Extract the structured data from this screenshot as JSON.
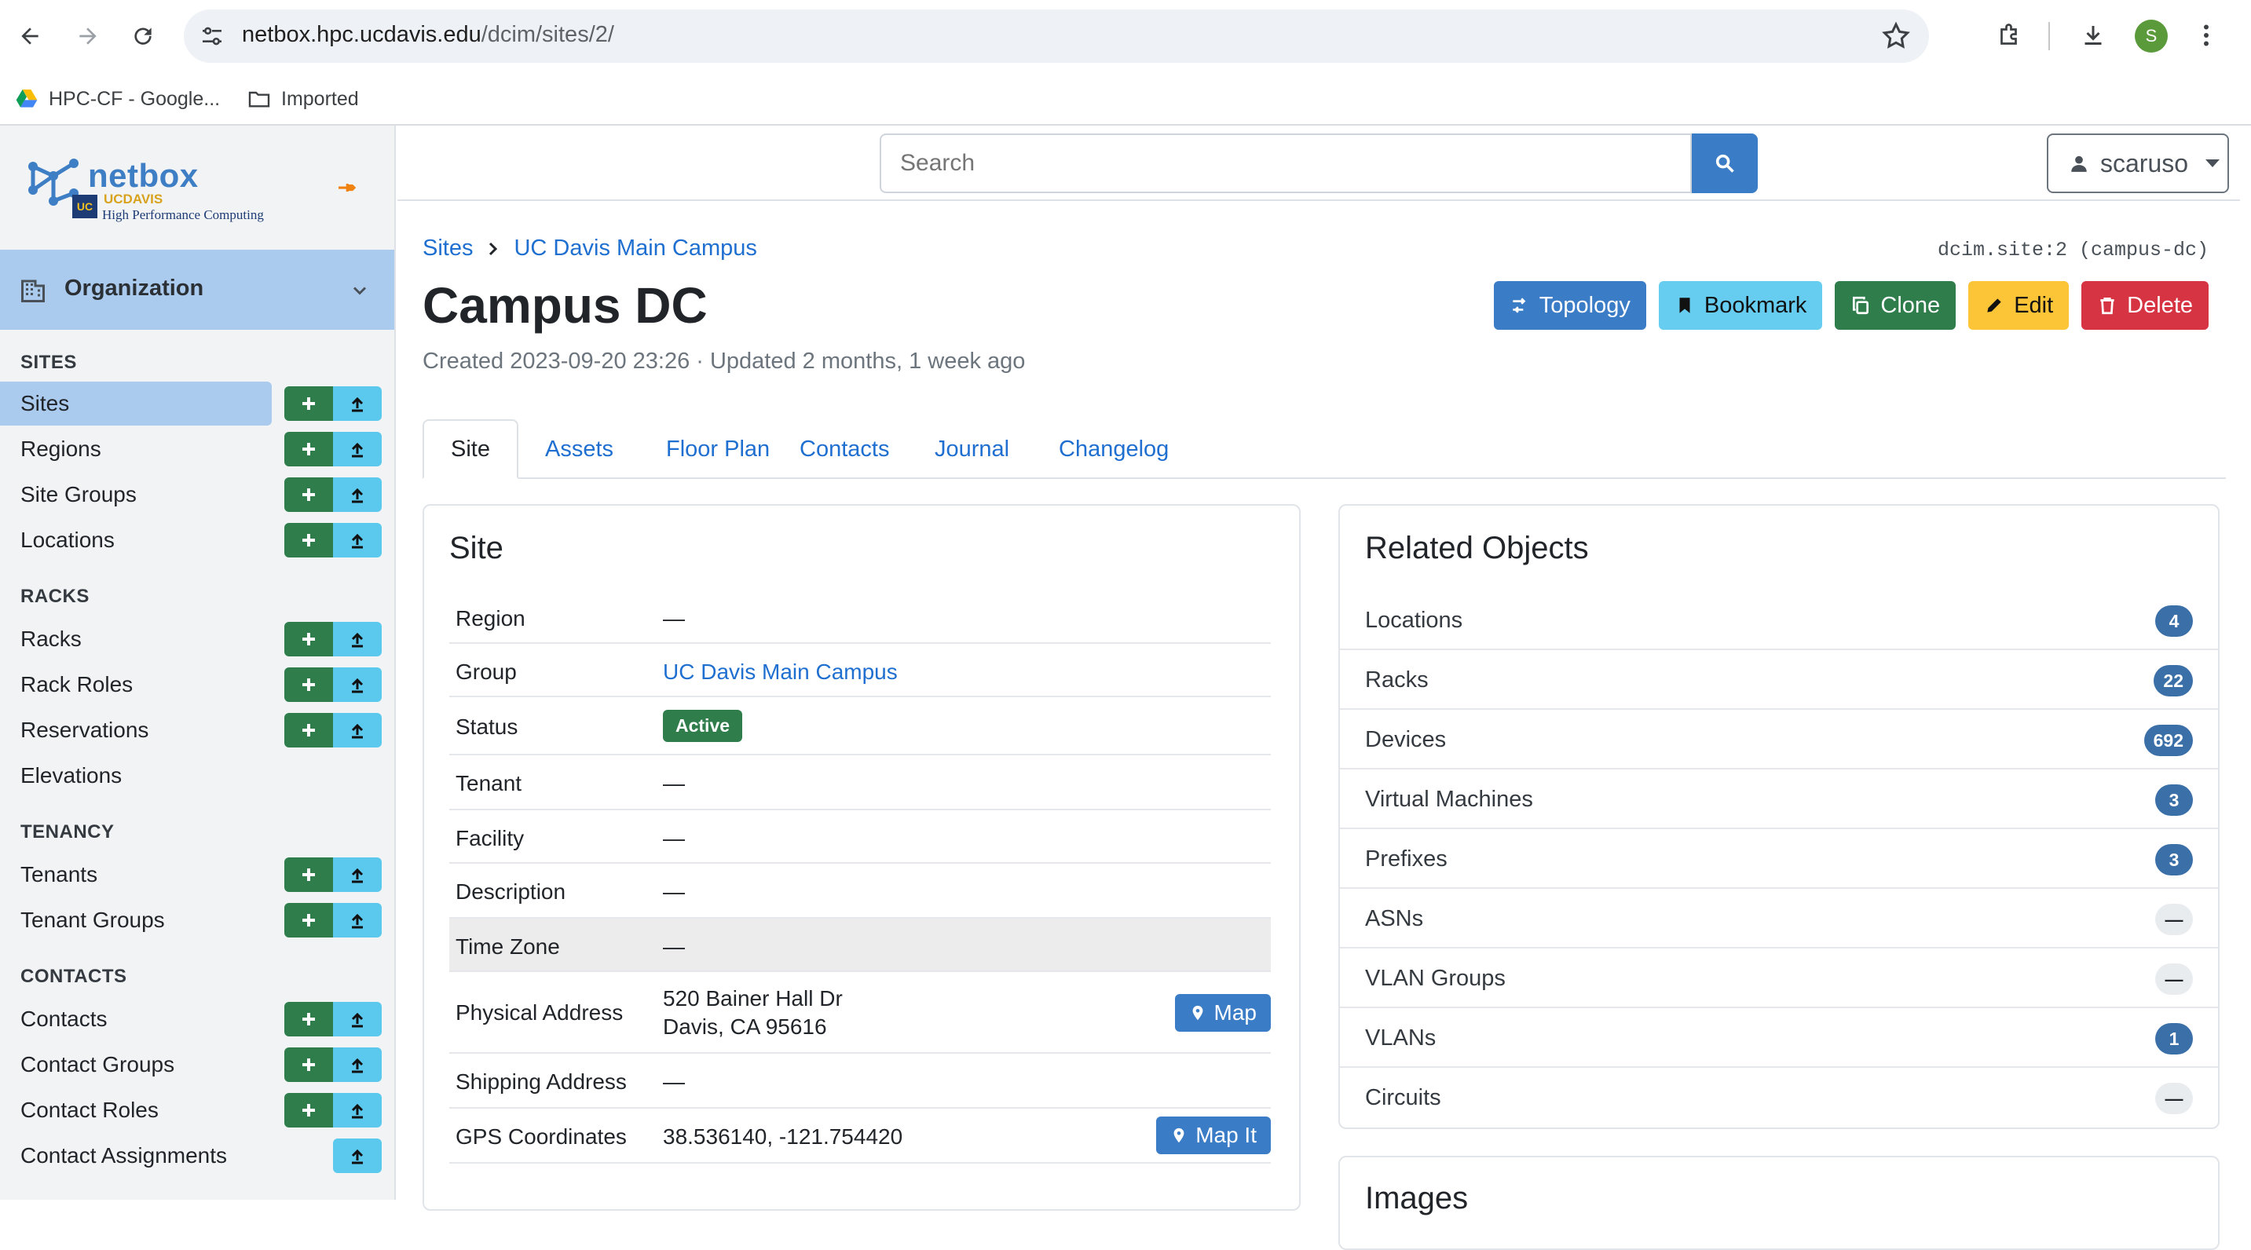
{
  "browser": {
    "url_host": "netbox.hpc.ucdavis.edu",
    "url_path": "/dcim/sites/2/",
    "profile_initial": "S",
    "bookmarks": [
      {
        "label": "HPC-CF - Google..."
      },
      {
        "label": "Imported"
      }
    ]
  },
  "brand": {
    "name": "netbox",
    "org_line1": "UCDAVIS",
    "org_line2": "High Performance Computing",
    "badge": "UC"
  },
  "sidebar": {
    "menu_title": "Organization",
    "sections": {
      "sites": "SITES",
      "racks": "RACKS",
      "tenancy": "TENANCY",
      "contacts": "CONTACTS"
    },
    "items": {
      "sites": "Sites",
      "regions": "Regions",
      "site_groups": "Site Groups",
      "locations": "Locations",
      "racks": "Racks",
      "rack_roles": "Rack Roles",
      "reservations": "Reservations",
      "elevations": "Elevations",
      "tenants": "Tenants",
      "tenant_groups": "Tenant Groups",
      "contacts": "Contacts",
      "contact_groups": "Contact Groups",
      "contact_roles": "Contact Roles",
      "contact_assignments": "Contact Assignments"
    }
  },
  "header": {
    "search_placeholder": "Search",
    "username": "scaruso"
  },
  "page": {
    "breadcrumb": [
      "Sites",
      "UC Davis Main Campus"
    ],
    "object_id": "dcim.site:2 (campus-dc)",
    "title": "Campus DC",
    "meta": "Created 2023-09-20 23:26 · Updated 2 months, 1 week ago",
    "actions": {
      "topology": "Topology",
      "bookmark": "Bookmark",
      "clone": "Clone",
      "edit": "Edit",
      "delete": "Delete"
    },
    "tabs": [
      "Site",
      "Assets",
      "Floor Plan",
      "Contacts",
      "Journal",
      "Changelog"
    ]
  },
  "site_card": {
    "title": "Site",
    "rows": {
      "region": {
        "key": "Region",
        "value": "—"
      },
      "group": {
        "key": "Group",
        "value": "UC Davis Main Campus"
      },
      "status": {
        "key": "Status",
        "value": "Active"
      },
      "tenant": {
        "key": "Tenant",
        "value": "—"
      },
      "facility": {
        "key": "Facility",
        "value": "—"
      },
      "description": {
        "key": "Description",
        "value": "—"
      },
      "time_zone": {
        "key": "Time Zone",
        "value": "—"
      },
      "physical_address": {
        "key": "Physical Address",
        "line1": "520 Bainer Hall Dr",
        "line2": "Davis, CA 95616",
        "button": "Map"
      },
      "shipping_address": {
        "key": "Shipping Address",
        "value": "—"
      },
      "gps": {
        "key": "GPS Coordinates",
        "value": "38.536140, -121.754420",
        "button": "Map It"
      }
    }
  },
  "related": {
    "title": "Related Objects",
    "items": [
      {
        "label": "Locations",
        "count": "4"
      },
      {
        "label": "Racks",
        "count": "22"
      },
      {
        "label": "Devices",
        "count": "692"
      },
      {
        "label": "Virtual Machines",
        "count": "3"
      },
      {
        "label": "Prefixes",
        "count": "3"
      },
      {
        "label": "ASNs",
        "count": "—"
      },
      {
        "label": "VLAN Groups",
        "count": "—"
      },
      {
        "label": "VLANs",
        "count": "1"
      },
      {
        "label": "Circuits",
        "count": "—"
      }
    ]
  },
  "images_card": {
    "title": "Images"
  },
  "colors": {
    "primary": "#3b7cc7",
    "success": "#2f7d4b",
    "info": "#66cdf0",
    "warning": "#fcc537",
    "danger": "#d63343",
    "sidebar_active": "#abcbee"
  }
}
